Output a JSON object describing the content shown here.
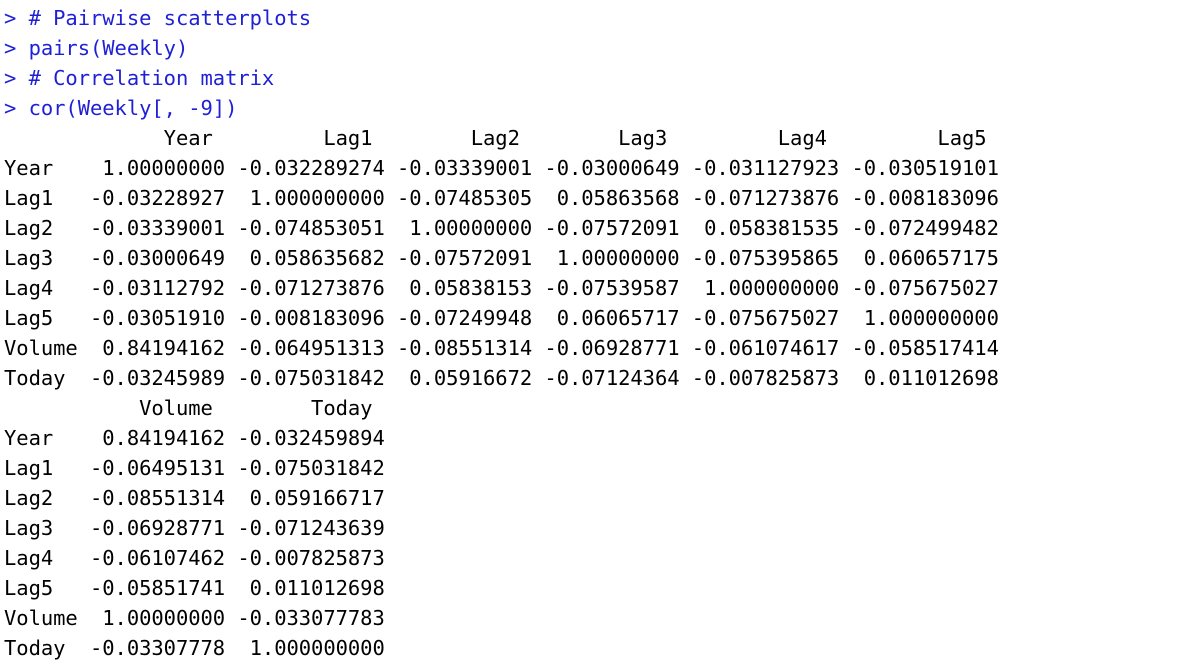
{
  "console": {
    "prompt": "> ",
    "commands": [
      "# Pairwise scatterplots",
      "pairs(Weekly)",
      "# Correlation matrix",
      "cor(Weekly[, -9])"
    ],
    "output_block_1": {
      "header": "             Year         Lag1        Lag2        Lag3         Lag4         Lag5",
      "rows": [
        "Year    1.00000000 -0.032289274 -0.03339001 -0.03000649 -0.031127923 -0.030519101",
        "Lag1   -0.03228927  1.000000000 -0.07485305  0.05863568 -0.071273876 -0.008183096",
        "Lag2   -0.03339001 -0.074853051  1.00000000 -0.07572091  0.058381535 -0.072499482",
        "Lag3   -0.03000649  0.058635682 -0.07572091  1.00000000 -0.075395865  0.060657175",
        "Lag4   -0.03112792 -0.071273876  0.05838153 -0.07539587  1.000000000 -0.075675027",
        "Lag5   -0.03051910 -0.008183096 -0.07249948  0.06065717 -0.075675027  1.000000000",
        "Volume  0.84194162 -0.064951313 -0.08551314 -0.06928771 -0.061074617 -0.058517414",
        "Today  -0.03245989 -0.075031842  0.05916672 -0.07124364 -0.007825873  0.011012698"
      ]
    },
    "output_block_2": {
      "header": "           Volume        Today",
      "rows": [
        "Year    0.84194162 -0.032459894",
        "Lag1   -0.06495131 -0.075031842",
        "Lag2   -0.08551314  0.059166717",
        "Lag3   -0.06928771 -0.071243639",
        "Lag4   -0.06107462 -0.007825873",
        "Lag5   -0.05851741  0.011012698",
        "Volume  1.00000000 -0.033077783",
        "Today  -0.03307778  1.000000000"
      ]
    },
    "colors": {
      "command": "#1f1fd6",
      "output": "#000000",
      "background": "#ffffff"
    }
  }
}
